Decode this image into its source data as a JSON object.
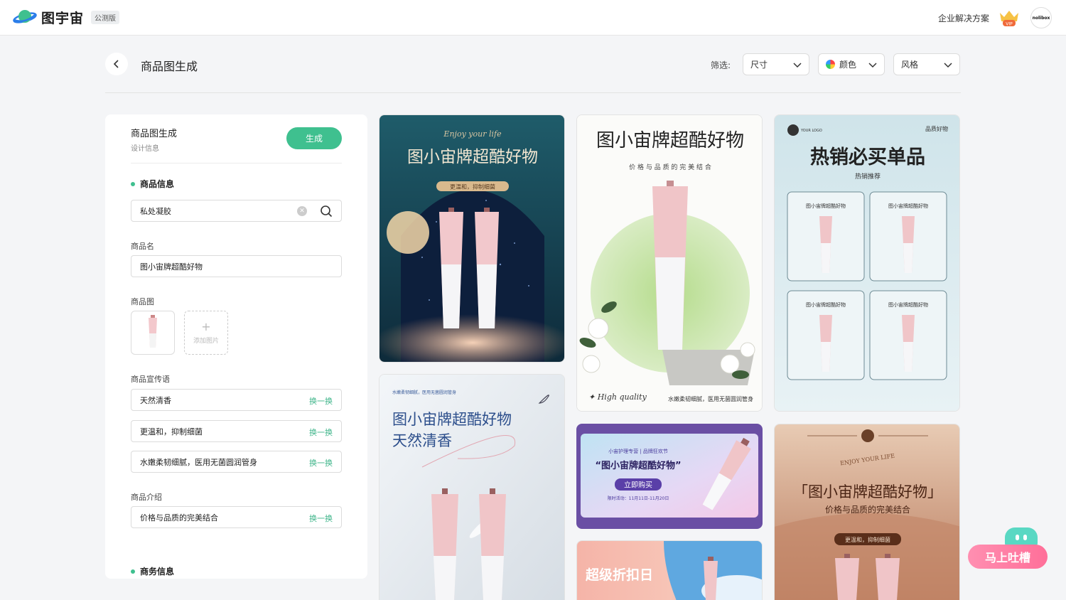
{
  "header": {
    "brand": "图宇宙",
    "beta_badge": "公测版",
    "enterprise": "企业解决方案",
    "vip_label": "VIP",
    "avatar_text": "nolibox"
  },
  "toolbar": {
    "title": "商品图生成",
    "filter_label": "筛选:",
    "size": "尺寸",
    "color": "颜色",
    "style": "风格"
  },
  "panel": {
    "title": "商品图生成",
    "subtitle": "设计信息",
    "generate": "生成",
    "section_product": "商品信息",
    "category_value": "私处凝胶",
    "name_label": "商品名",
    "name_value": "图小宙牌超酷好物",
    "image_label": "商品图",
    "add_image": "添加图片",
    "slogan_label": "商品宣传语",
    "swap": "换一换",
    "slogans": [
      "天然清香",
      "更温和，抑制细菌",
      "水嫩柔韧细腻，医用无菌圆润管身"
    ],
    "intro_label": "商品介绍",
    "intro_value": "价格与品质的完美结合",
    "section_business": "商务信息"
  },
  "cards": {
    "c1": {
      "script": "Enjoy your life",
      "title": "图小宙牌超酷好物",
      "tag": "更温和，抑制细菌"
    },
    "c2": {
      "title": "图小宙牌超酷好物",
      "sub": "价 格 与 品 质 的 完 美 结 合",
      "footer_left": "✦ High quality",
      "footer_right": "水嫩柔韧细腻，医用无菌圆润管身"
    },
    "c3": {
      "logo": "YOUR LOGO",
      "corner": "品质好物",
      "title": "热销必买单品",
      "sub": "热销推荐",
      "item": "图小宙牌超酷好物"
    },
    "c4": {
      "small": "水嫩柔韧细腻，医用无菌圆润管身",
      "title1": "图小宙牌超酷好物",
      "title2": "天然清香"
    },
    "c5": {
      "top": "小宙护理专营 | 品牌狂欢节",
      "title": "“图小宙牌超酷好物”",
      "btn": "立即购买",
      "date": "限时活动：11月11日-11月20日"
    },
    "c6": {
      "title": "超级折扣日"
    },
    "c7": {
      "script": "ENJOY YOUR LIFE",
      "title": "「图小宙牌超酷好物」",
      "sub": "价格与品质的完美结合",
      "tag": "更温和，抑制细菌"
    }
  },
  "feedback": {
    "label": "马上吐槽"
  }
}
